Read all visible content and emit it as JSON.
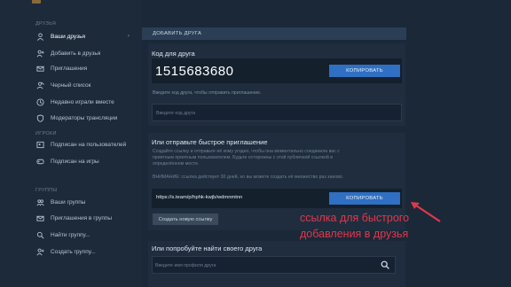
{
  "sidebar": {
    "section_friends": "ДРУЗЬЯ",
    "items": [
      {
        "label": "Ваши друзья",
        "icon": "person-icon",
        "chevron": "›"
      },
      {
        "label": "Добавить в друзья",
        "icon": "add-friend-icon"
      },
      {
        "label": "Приглашения",
        "icon": "mail-icon"
      },
      {
        "label": "Черный список",
        "icon": "block-icon"
      },
      {
        "label": "Недавно играли вместе",
        "icon": "clock-icon"
      },
      {
        "label": "Модераторы трансляции",
        "icon": "shield-icon"
      }
    ],
    "section_following": "ИГРОКИ",
    "following": [
      {
        "label": "Подписан на пользователей",
        "icon": "people-icon"
      },
      {
        "label": "Подписан на игры",
        "icon": "gamepad-icon"
      }
    ],
    "section_groups": "ГРУППЫ",
    "groups": [
      {
        "label": "Ваши группы",
        "icon": "group-icon"
      },
      {
        "label": "Приглашения в группы",
        "icon": "group-mail-icon"
      },
      {
        "label": "Найти группу...",
        "icon": "search-group-icon"
      },
      {
        "label": "Создать группу...",
        "icon": "add-group-icon"
      }
    ]
  },
  "main": {
    "tab": "ДОБАВИТЬ ДРУГА",
    "code_section": {
      "title": "Код для друга",
      "code": "1515683680",
      "copy_button": "КОПИРОВАТЬ",
      "hint": "Введите код друга, чтобы отправить приглашение.",
      "input_placeholder": "Введите код друга"
    },
    "invite_section": {
      "title": "Или отправьте быстрое приглашение",
      "description_line1": "Создайте ссылку и отправьте её кому угодно, чтобы она моментально соединила вас с",
      "description_line2": "приятным приятным пользователем. Будьте осторожны с этой публичной ссылкой в",
      "description_line3": "определённом месте.",
      "note": "ВНИМАНИЕ: ссылка действует 30 дней, но вы можете создать её множество раз заново.",
      "link": "https://s.team/p/hphk-kwjb/wdmnmtnn",
      "copy_button": "КОПИРОВАТЬ",
      "new_link_button": "Создать новую ссылку"
    },
    "search_section": {
      "title": "Или попробуйте найти своего друга",
      "placeholder": "Введите имя профиля друга"
    },
    "annotation": {
      "line1": "ссылка для быстрого",
      "line2": "добавления в друзья",
      "color": "#e0384b"
    }
  }
}
